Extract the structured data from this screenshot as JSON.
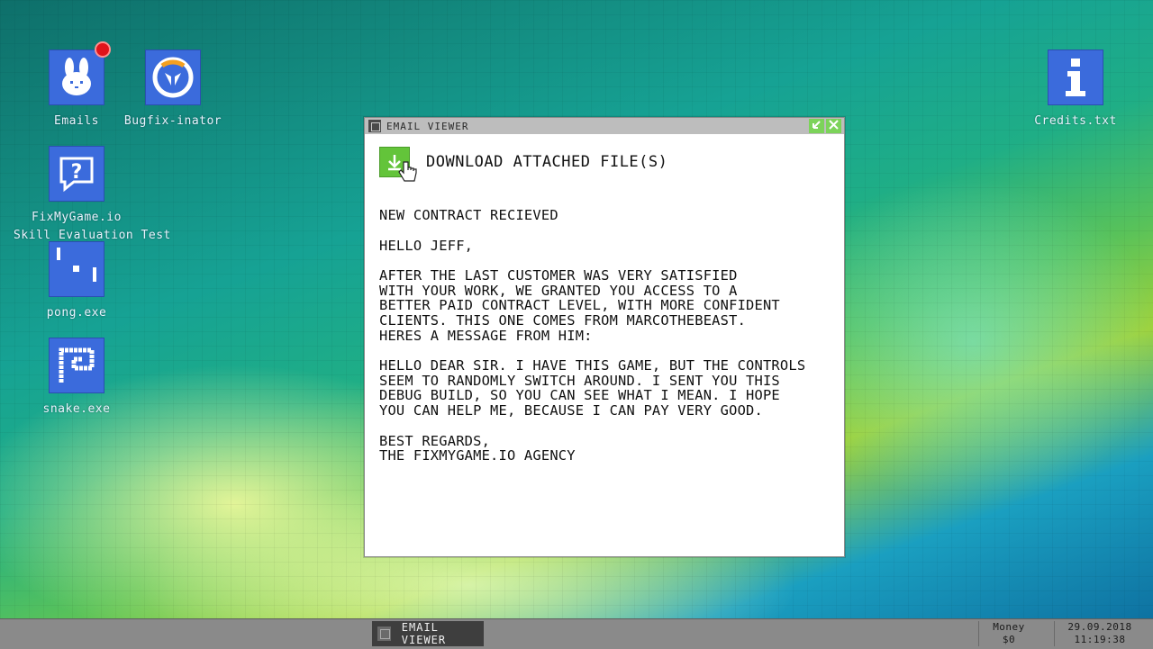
{
  "desktop": {
    "icons": [
      {
        "label": "Emails"
      },
      {
        "label": "Bugfix-inator"
      },
      {
        "label": "FixMyGame.io\nSkill Evaluation Test"
      },
      {
        "label": "pong.exe"
      },
      {
        "label": "snake.exe"
      },
      {
        "label": "Credits.txt"
      }
    ],
    "email_badge_color": "#e0141b"
  },
  "window": {
    "title": "EMAIL VIEWER",
    "download_label": "DOWNLOAD ATTACHED FILE(S)",
    "subject": "NEW CONTRACT RECIEVED",
    "greeting": "HELLO JEFF,",
    "body1": "AFTER THE LAST CUSTOMER WAS VERY SATISFIED\nWITH YOUR WORK, WE GRANTED YOU ACCESS TO A\nBETTER PAID CONTRACT LEVEL, WITH MORE CONFIDENT\nCLIENTS. THIS ONE COMES FROM MARCOTHEBEAST.\nHERES A MESSAGE FROM HIM:",
    "body2": "HELLO DEAR SIR. I HAVE THIS GAME, BUT THE CONTROLS\nSEEM TO RANDOMLY SWITCH AROUND. I SENT YOU THIS\nDEBUG BUILD, SO YOU CAN SEE WHAT I MEAN. I HOPE\nYOU CAN HELP ME, BECAUSE I CAN PAY VERY GOOD.",
    "signoff": "BEST REGARDS,\nTHE FIXMYGAME.IO AGENCY"
  },
  "taskbar": {
    "task_label": "EMAIL VIEWER",
    "money_label": "Money",
    "money_value": "$0",
    "date": "29.09.2018",
    "time": "11:19:38"
  },
  "colors": {
    "accent_green": "#63c43a",
    "icon_blue": "#3b6bdc"
  }
}
